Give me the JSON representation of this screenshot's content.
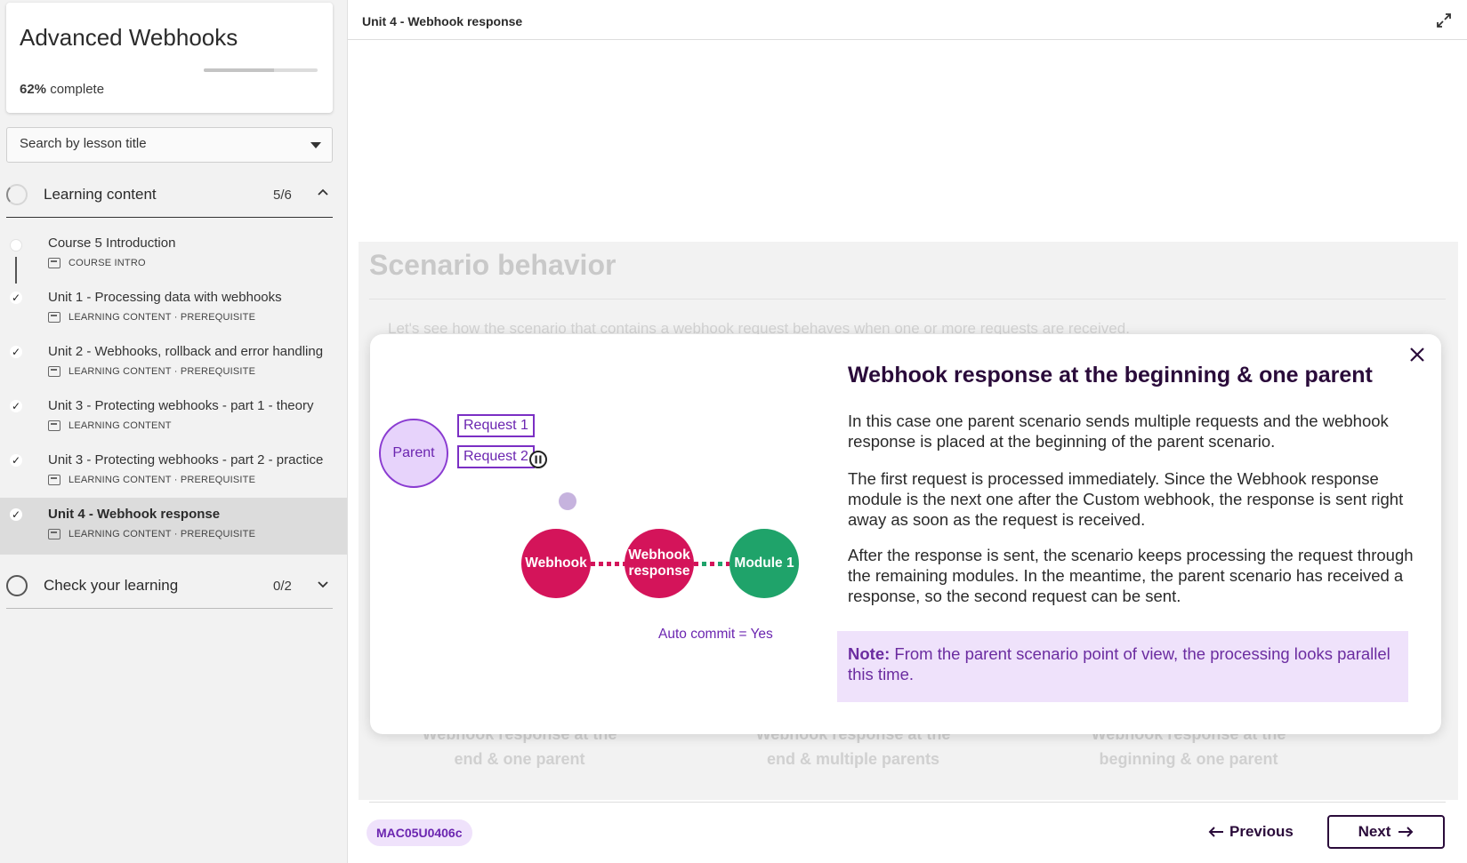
{
  "course": {
    "title": "Advanced Webhooks",
    "progress_percent": 62,
    "progress_percent_label": "62%",
    "progress_suffix": " complete"
  },
  "search": {
    "placeholder": "Search by lesson title"
  },
  "sections": [
    {
      "label": "Learning content",
      "count": "5/6"
    },
    {
      "label": "Check your learning",
      "count": "0/2"
    }
  ],
  "lessons": [
    {
      "title": "Course 5 Introduction",
      "meta": "COURSE INTRO",
      "completed": false,
      "active": false
    },
    {
      "title": "Unit 1 - Processing data with webhooks",
      "meta": "LEARNING CONTENT · PREREQUISITE",
      "completed": true,
      "active": false
    },
    {
      "title": "Unit 2 - Webhooks, rollback and error handling",
      "meta": "LEARNING CONTENT · PREREQUISITE",
      "completed": true,
      "active": false
    },
    {
      "title": "Unit 3 - Protecting webhooks - part 1 - theory",
      "meta": "LEARNING CONTENT",
      "completed": true,
      "active": false
    },
    {
      "title": "Unit 3 - Protecting webhooks - part 2 - practice",
      "meta": "LEARNING CONTENT · PREREQUISITE",
      "completed": true,
      "active": false
    },
    {
      "title": "Unit 4 - Webhook response",
      "meta": "LEARNING CONTENT · PREREQUISITE",
      "completed": true,
      "active": true
    }
  ],
  "header": {
    "unit_title": "Unit 4 - Webhook response"
  },
  "page": {
    "heading": "Scenario behavior",
    "intro": "Let's see how the scenario that contains a webhook request behaves when one or more requests are received.",
    "captions": [
      [
        "Webhook response at the",
        "end & one parent"
      ],
      [
        "Webhook response at the",
        "end & multiple parents"
      ],
      [
        "Webhook response at the",
        "beginning & one parent"
      ]
    ]
  },
  "modal": {
    "heading": "Webhook response at the beginning & one parent",
    "paragraphs": [
      "In this case one parent scenario sends multiple requests and the webhook response is placed at the beginning of the parent scenario.",
      "The first request is processed immediately. Since the Webhook response module is the next one after the Custom webhook, the response is sent right away as soon as the request is received.",
      "After the response is sent, the scenario keeps processing the request through the remaining modules. In the meantime, the parent scenario has received a response, so the second request can be sent."
    ],
    "note_label": "Note:",
    "note_text": " From the parent scenario point of view, the processing looks parallel this time.",
    "diagram": {
      "parent": "Parent",
      "requests": [
        "Request 1",
        "Request 2"
      ],
      "modules": [
        "Webhook",
        "Webhook response",
        "Module 1"
      ],
      "auto_commit": "Auto commit = Yes"
    }
  },
  "footer": {
    "code": "MAC05U0406c",
    "previous": "Previous",
    "next": "Next"
  },
  "colors": {
    "accent_purple": "#6b25b0",
    "module_pink": "#d4145a",
    "module_green": "#1fa36a",
    "note_bg": "#efe2fb"
  }
}
